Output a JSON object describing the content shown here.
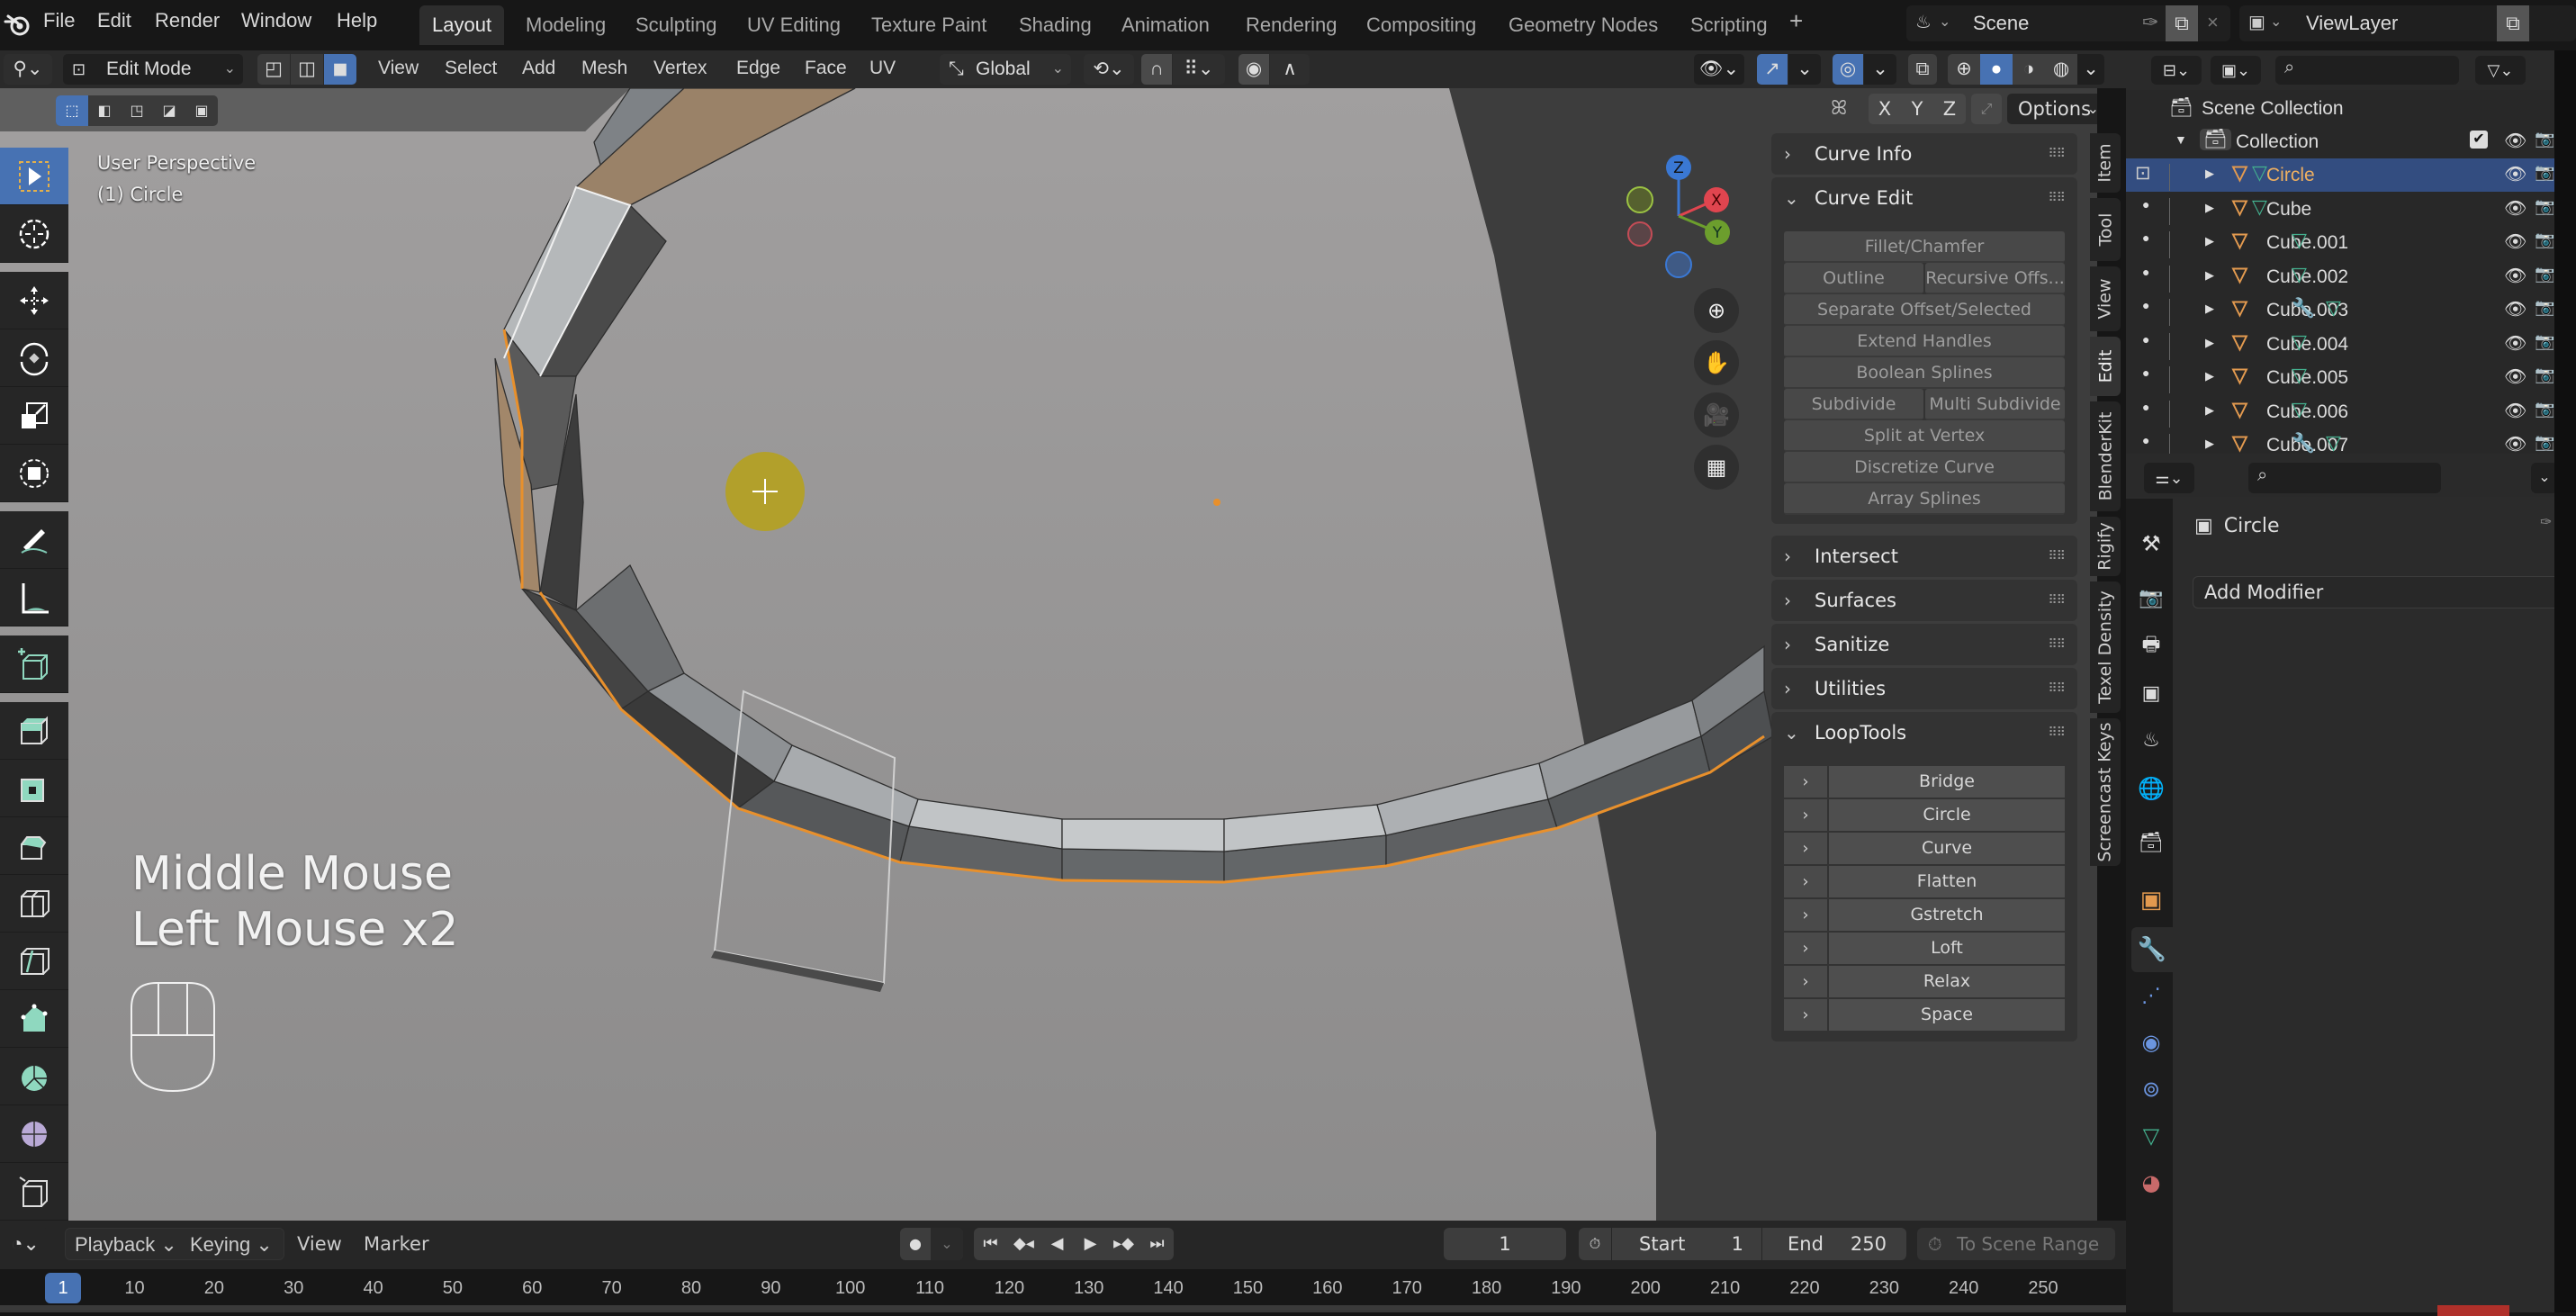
{
  "topbar": {
    "menus": [
      "File",
      "Edit",
      "Render",
      "Window",
      "Help"
    ],
    "workspaces": [
      {
        "label": "Layout",
        "active": true
      },
      {
        "label": "Modeling"
      },
      {
        "label": "Sculpting"
      },
      {
        "label": "UV Editing"
      },
      {
        "label": "Texture Paint"
      },
      {
        "label": "Shading"
      },
      {
        "label": "Animation"
      },
      {
        "label": "Rendering"
      },
      {
        "label": "Compositing"
      },
      {
        "label": "Geometry Nodes"
      },
      {
        "label": "Scripting"
      }
    ],
    "add_workspace": "+",
    "scene": "Scene",
    "view_layer": "ViewLayer"
  },
  "viewport_header": {
    "mode": "Edit Mode",
    "menus": [
      "View",
      "Select",
      "Add",
      "Mesh",
      "Vertex",
      "Edge",
      "Face",
      "UV"
    ],
    "transform_orientation": "Global",
    "select_mode_active": "face",
    "shading_active": "solid",
    "mirror_axes": [
      "X",
      "Y",
      "Z"
    ],
    "options_label": "Options"
  },
  "viewport": {
    "view_name": "User Perspective",
    "object_info": "(1) Circle",
    "screencast_lines": [
      "Middle Mouse",
      "Left Mouse x2"
    ],
    "gizmo_axes": {
      "z": "Z",
      "x": "X",
      "y": "Y"
    },
    "colors": {
      "selection": "#e8902c",
      "axis_x": "#e0454f",
      "axis_y": "#6c9e2d",
      "axis_z": "#3a78d4",
      "active_tool": "#4772b3"
    }
  },
  "npanel": {
    "sections": [
      {
        "title": "Curve Info",
        "expanded": false
      },
      {
        "title": "Curve Edit",
        "expanded": true
      },
      {
        "title": "Intersect",
        "expanded": false
      },
      {
        "title": "Surfaces",
        "expanded": false
      },
      {
        "title": "Sanitize",
        "expanded": false
      },
      {
        "title": "Utilities",
        "expanded": false
      },
      {
        "title": "LoopTools",
        "expanded": true
      }
    ],
    "curve_edit_buttons": {
      "fillet": "Fillet/Chamfer",
      "outline": "Outline",
      "recursive": "Recursive Offs...",
      "separate": "Separate Offset/Selected",
      "extend": "Extend Handles",
      "boolean": "Boolean Splines",
      "subdivide": "Subdivide",
      "multi_subdivide": "Multi Subdivide",
      "split": "Split at Vertex",
      "discretize": "Discretize Curve",
      "array": "Array Splines"
    },
    "looptools": [
      "Bridge",
      "Circle",
      "Curve",
      "Flatten",
      "Gstretch",
      "Loft",
      "Relax",
      "Space"
    ],
    "side_tabs": [
      "Item",
      "Tool",
      "View",
      "Edit",
      "BlenderKit",
      "Rigify",
      "Texel Density",
      "Screencast Keys"
    ],
    "active_side_tab": "Edit"
  },
  "outliner": {
    "root": "Scene Collection",
    "collection": "Collection",
    "items": [
      {
        "name": "Circle",
        "selected": true,
        "modifier": false
      },
      {
        "name": "Cube",
        "modifier": false
      },
      {
        "name": "Cube.001",
        "modifier": false
      },
      {
        "name": "Cube.002",
        "modifier": false
      },
      {
        "name": "Cube.003",
        "modifier": true
      },
      {
        "name": "Cube.004",
        "modifier": false
      },
      {
        "name": "Cube.005",
        "modifier": false
      },
      {
        "name": "Cube.006",
        "modifier": false
      },
      {
        "name": "Cube.007",
        "modifier": true
      }
    ]
  },
  "properties": {
    "object_name": "Circle",
    "add_modifier": "Add Modifier",
    "active_tab": "modifiers"
  },
  "timeline": {
    "menus": {
      "playback": "Playback",
      "keying": "Keying",
      "view": "View",
      "marker": "Marker"
    },
    "current_frame": "1",
    "start_label": "Start",
    "start": "1",
    "end_label": "End",
    "end": "250",
    "scene_range": "To Scene Range",
    "ticks": [
      "1",
      "10",
      "20",
      "30",
      "40",
      "50",
      "60",
      "70",
      "80",
      "90",
      "100",
      "110",
      "120",
      "130",
      "140",
      "150",
      "160",
      "170",
      "180",
      "190",
      "200",
      "210",
      "220",
      "230",
      "240",
      "250"
    ]
  }
}
